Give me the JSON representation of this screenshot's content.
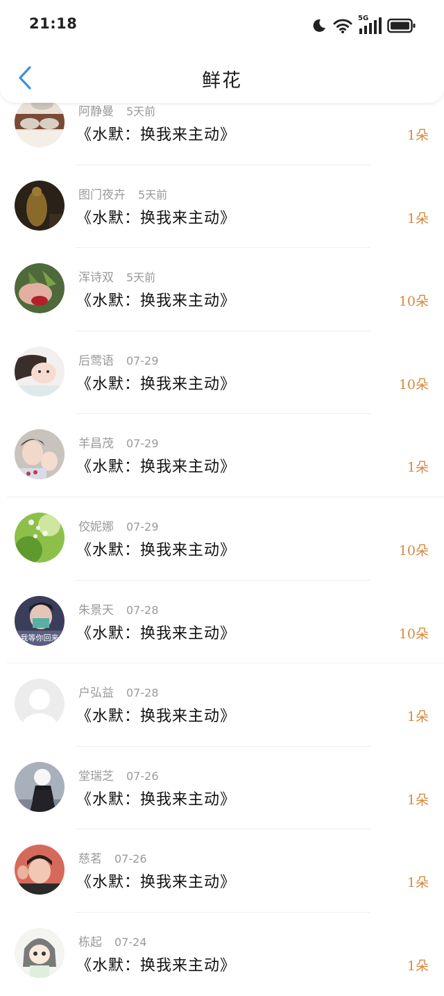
{
  "status_bar": {
    "time": "21:18",
    "network_label": "5G"
  },
  "nav": {
    "title": "鲜花"
  },
  "colors": {
    "accent_blue": "#3a8ee6",
    "count_orange": "#d6893f",
    "meta_gray": "#9a9a9a"
  },
  "items": [
    {
      "name": "阿静曼",
      "time": "5天前",
      "book": "《水默：换我来主动》",
      "count": "1朵",
      "avatar": "photo-avatar"
    },
    {
      "name": "图门夜卉",
      "time": "5天前",
      "book": "《水默：换我来主动》",
      "count": "1朵",
      "avatar": "photo-avatar"
    },
    {
      "name": "浑诗双",
      "time": "5天前",
      "book": "《水默：换我来主动》",
      "count": "10朵",
      "avatar": "photo-avatar"
    },
    {
      "name": "后莺语",
      "time": "07-29",
      "book": "《水默：换我来主动》",
      "count": "10朵",
      "avatar": "photo-avatar"
    },
    {
      "name": "羊昌茂",
      "time": "07-29",
      "book": "《水默：换我来主动》",
      "count": "1朵",
      "avatar": "photo-avatar"
    },
    {
      "name": "佼妮娜",
      "time": "07-29",
      "book": "《水默：换我来主动》",
      "count": "10朵",
      "avatar": "photo-avatar"
    },
    {
      "name": "朱景天",
      "time": "07-28",
      "book": "《水默：换我来主动》",
      "count": "10朵",
      "avatar": "photo-avatar",
      "avatar_caption": "我等你回来"
    },
    {
      "name": "户弘益",
      "time": "07-28",
      "book": "《水默：换我来主动》",
      "count": "1朵",
      "avatar": "default-avatar"
    },
    {
      "name": "堂瑞芝",
      "time": "07-26",
      "book": "《水默：换我来主动》",
      "count": "1朵",
      "avatar": "photo-avatar"
    },
    {
      "name": "慈茗",
      "time": "07-26",
      "book": "《水默：换我来主动》",
      "count": "1朵",
      "avatar": "photo-avatar"
    },
    {
      "name": "栋起",
      "time": "07-24",
      "book": "《水默：换我来主动》",
      "count": "1朵",
      "avatar": "cartoon-avatar"
    }
  ]
}
